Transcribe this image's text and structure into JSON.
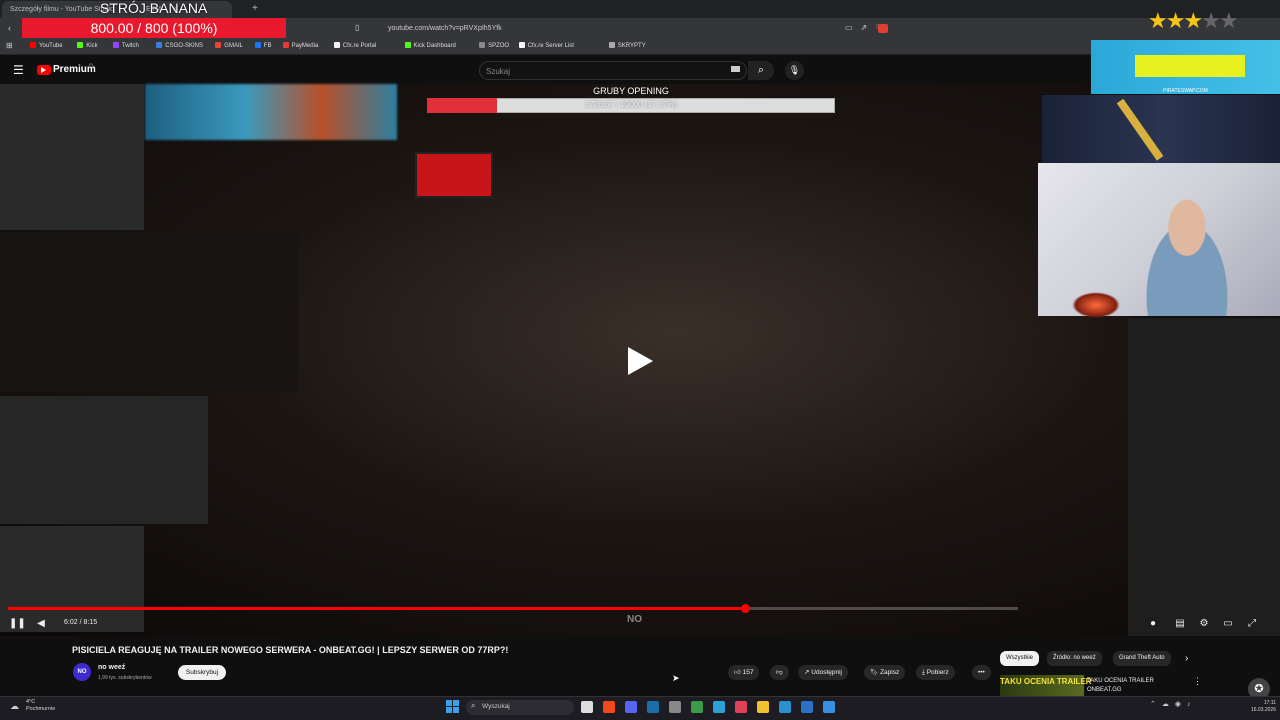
{
  "browser": {
    "tab_title": "Szczegóły filmu - YouTube Studio",
    "tab2_title": "E NA",
    "new_tab": "+",
    "url": "youtube.com/watch?v=pRVXpIh5Yfk",
    "bookmarks": [
      {
        "label": "YouTube",
        "color": "#ff0000"
      },
      {
        "label": "Kick",
        "color": "#53fc18"
      },
      {
        "label": "Twitch",
        "color": "#9146ff"
      },
      {
        "label": "CSGO-SKINS",
        "color": "#3b7ddd"
      },
      {
        "label": "GMAIL",
        "color": "#ea4335"
      },
      {
        "label": "FB",
        "color": "#1877f2"
      },
      {
        "label": "PayMedia",
        "color": "#e53935"
      },
      {
        "label": "Cfx.re Portal",
        "color": "#f5f5f5"
      },
      {
        "label": "Kick Dashboard",
        "color": "#53fc18"
      },
      {
        "label": "SPZOO",
        "color": "#888888"
      },
      {
        "label": "Cfx.re Server List",
        "color": "#f5f5f5"
      },
      {
        "label": "SKRYPTY",
        "color": "#aaaaaa"
      }
    ]
  },
  "overlay": {
    "title": "STRÓJ BANANA",
    "hp_text": "800.00 / 800 (100%)",
    "goal_title": "GRUBY OPENING",
    "goal_text": "1726.57 / 10000 (17.27%)",
    "goal_fraction": 0.1727,
    "stars_on": 3,
    "stars_total": 5,
    "ad_label": "PIRATESWAP.COM"
  },
  "youtube": {
    "logo": "Premium",
    "logo_region": "PL",
    "search_placeholder": "Szukaj",
    "player": {
      "time": "6:02 / 8:15",
      "progress_fraction": 0.73,
      "watermark": "NO"
    },
    "video_title": "PISICIELA REAGUJĘ NA TRAILER NOWEGO SERWERA - ONBEAT.GG! | LEPSZY SERWER OD 77RP?!",
    "channel": {
      "avatar": "NO",
      "name": "no weeź",
      "subs": "1,99 tys. subskrybentów",
      "subscribe": "Subskrybuj"
    },
    "actions": {
      "likes": "157",
      "share": "Udostępnij",
      "save": "Zapisz",
      "download": "Pobierz",
      "more": "•••"
    },
    "chips": [
      "Wszystkie",
      "Źródło: no weeź",
      "Grand Theft Auto"
    ],
    "recommended": {
      "thumb_text": "TAKU OCENIA TRAILER",
      "title": "TAKU OCENIA TRAILER ONBEAT.GG"
    }
  },
  "taskbar": {
    "weather_temp": "4°C",
    "weather_desc": "Pochmurnie",
    "search": "Wyszukaj",
    "time": "17:11",
    "date": "16.03.2026"
  }
}
